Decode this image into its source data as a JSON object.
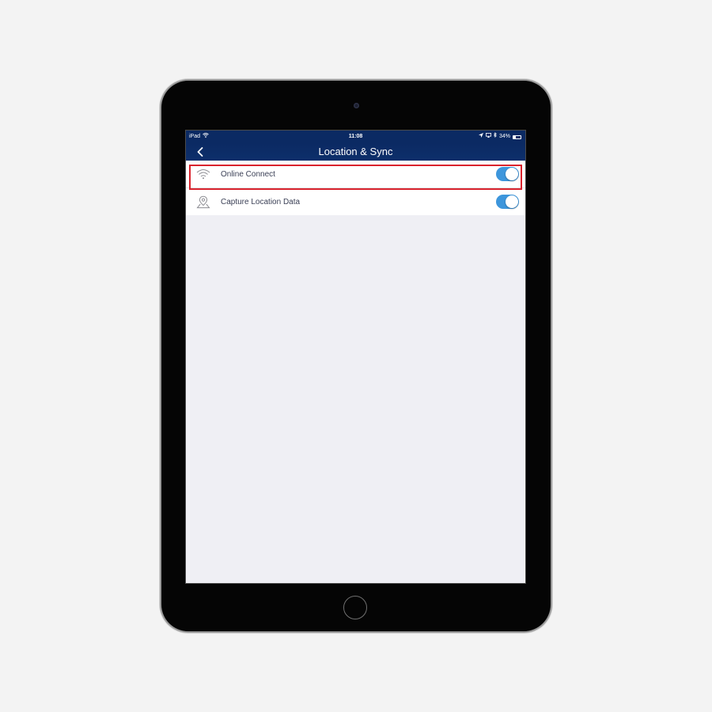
{
  "status_bar": {
    "device": "iPad",
    "time": "11:08",
    "battery": "34%",
    "battery_level": 0.34
  },
  "nav": {
    "title": "Location & Sync",
    "back_icon": "chevron-left-icon"
  },
  "settings": [
    {
      "label": "Online Connect",
      "icon": "wifi-icon",
      "enabled": true,
      "highlighted": true
    },
    {
      "label": "Capture Location Data",
      "icon": "map-pin-icon",
      "enabled": true,
      "highlighted": false
    }
  ],
  "colors": {
    "nav_background": "#0b2a63",
    "toggle_on": "#3d96dc",
    "highlight_border": "#d9232d",
    "screen_background": "#efeff4"
  }
}
